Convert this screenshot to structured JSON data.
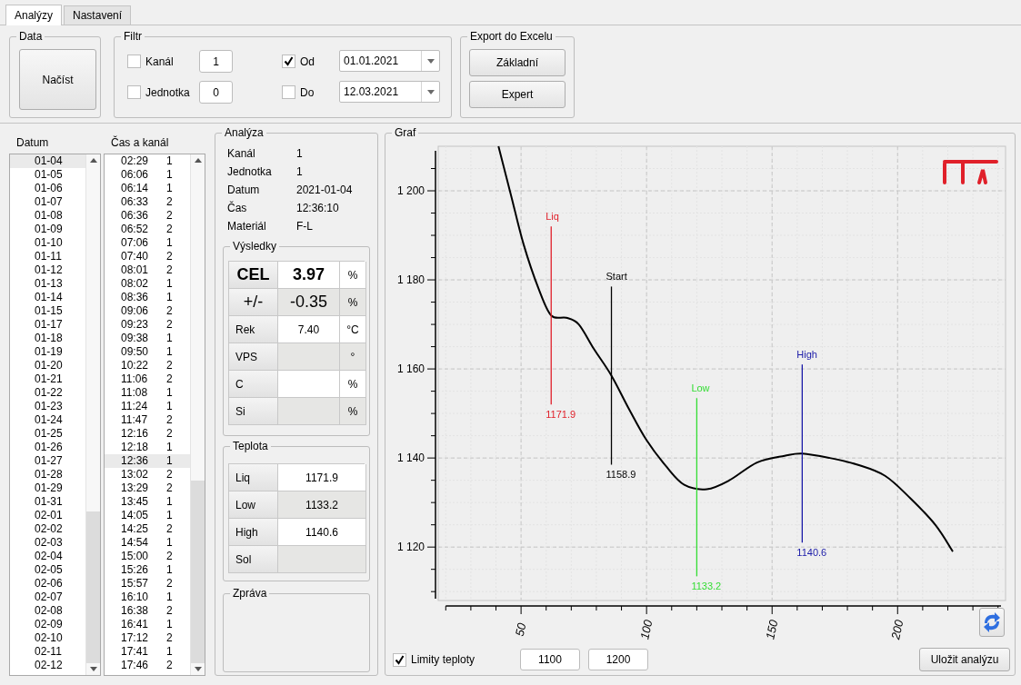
{
  "tabs": [
    {
      "label": "Analýzy",
      "selected": true
    },
    {
      "label": "Nastavení",
      "selected": false
    }
  ],
  "data_group": {
    "title": "Data",
    "button": "Načíst"
  },
  "filter": {
    "title": "Filtr",
    "fields": [
      {
        "label": "Kanál",
        "checked": false,
        "value": "1"
      },
      {
        "label": "Jednotka",
        "checked": false,
        "value": "0"
      }
    ],
    "dates": [
      {
        "label": "Od",
        "checked": true,
        "value": "01.01.2021"
      },
      {
        "label": "Do",
        "checked": false,
        "value": "12.03.2021"
      }
    ]
  },
  "export": {
    "title": "Export do Excelu",
    "buttons": [
      "Základní",
      "Expert"
    ]
  },
  "date_list": {
    "header": "Datum",
    "items": [
      {
        "label": "01-04",
        "selected": true
      },
      {
        "label": "01-05",
        "selected": false
      },
      {
        "label": "01-06",
        "selected": false
      },
      {
        "label": "01-07",
        "selected": false
      },
      {
        "label": "01-08",
        "selected": false
      },
      {
        "label": "01-09",
        "selected": false
      },
      {
        "label": "01-10",
        "selected": false
      },
      {
        "label": "01-11",
        "selected": false
      },
      {
        "label": "01-12",
        "selected": false
      },
      {
        "label": "01-13",
        "selected": false
      },
      {
        "label": "01-14",
        "selected": false
      },
      {
        "label": "01-15",
        "selected": false
      },
      {
        "label": "01-17",
        "selected": false
      },
      {
        "label": "01-18",
        "selected": false
      },
      {
        "label": "01-19",
        "selected": false
      },
      {
        "label": "01-20",
        "selected": false
      },
      {
        "label": "01-21",
        "selected": false
      },
      {
        "label": "01-22",
        "selected": false
      },
      {
        "label": "01-23",
        "selected": false
      },
      {
        "label": "01-24",
        "selected": false
      },
      {
        "label": "01-25",
        "selected": false
      },
      {
        "label": "01-26",
        "selected": false
      },
      {
        "label": "01-27",
        "selected": false
      },
      {
        "label": "01-28",
        "selected": false
      },
      {
        "label": "01-29",
        "selected": false
      },
      {
        "label": "01-31",
        "selected": false
      },
      {
        "label": "02-01",
        "selected": false
      },
      {
        "label": "02-02",
        "selected": false
      },
      {
        "label": "02-03",
        "selected": false
      },
      {
        "label": "02-04",
        "selected": false
      },
      {
        "label": "02-05",
        "selected": false
      },
      {
        "label": "02-06",
        "selected": false
      },
      {
        "label": "02-07",
        "selected": false
      },
      {
        "label": "02-08",
        "selected": false
      },
      {
        "label": "02-09",
        "selected": false
      },
      {
        "label": "02-10",
        "selected": false
      },
      {
        "label": "02-11",
        "selected": false
      },
      {
        "label": "02-12",
        "selected": false
      }
    ]
  },
  "time_list": {
    "header": "Čas a kanál",
    "items": [
      {
        "time": "02:29",
        "channel": "1",
        "selected": false
      },
      {
        "time": "06:06",
        "channel": "1",
        "selected": false
      },
      {
        "time": "06:14",
        "channel": "1",
        "selected": false
      },
      {
        "time": "06:33",
        "channel": "2",
        "selected": false
      },
      {
        "time": "06:36",
        "channel": "2",
        "selected": false
      },
      {
        "time": "06:52",
        "channel": "2",
        "selected": false
      },
      {
        "time": "07:06",
        "channel": "1",
        "selected": false
      },
      {
        "time": "07:40",
        "channel": "2",
        "selected": false
      },
      {
        "time": "08:01",
        "channel": "2",
        "selected": false
      },
      {
        "time": "08:02",
        "channel": "1",
        "selected": false
      },
      {
        "time": "08:36",
        "channel": "1",
        "selected": false
      },
      {
        "time": "09:06",
        "channel": "2",
        "selected": false
      },
      {
        "time": "09:23",
        "channel": "2",
        "selected": false
      },
      {
        "time": "09:38",
        "channel": "1",
        "selected": false
      },
      {
        "time": "09:50",
        "channel": "1",
        "selected": false
      },
      {
        "time": "10:22",
        "channel": "2",
        "selected": false
      },
      {
        "time": "11:06",
        "channel": "2",
        "selected": false
      },
      {
        "time": "11:08",
        "channel": "1",
        "selected": false
      },
      {
        "time": "11:24",
        "channel": "1",
        "selected": false
      },
      {
        "time": "11:47",
        "channel": "2",
        "selected": false
      },
      {
        "time": "12:16",
        "channel": "2",
        "selected": false
      },
      {
        "time": "12:18",
        "channel": "1",
        "selected": false
      },
      {
        "time": "12:36",
        "channel": "1",
        "selected": true
      },
      {
        "time": "13:02",
        "channel": "2",
        "selected": false
      },
      {
        "time": "13:29",
        "channel": "2",
        "selected": false
      },
      {
        "time": "13:45",
        "channel": "1",
        "selected": false
      },
      {
        "time": "14:05",
        "channel": "1",
        "selected": false
      },
      {
        "time": "14:25",
        "channel": "2",
        "selected": false
      },
      {
        "time": "14:54",
        "channel": "1",
        "selected": false
      },
      {
        "time": "15:00",
        "channel": "2",
        "selected": false
      },
      {
        "time": "15:26",
        "channel": "1",
        "selected": false
      },
      {
        "time": "15:57",
        "channel": "2",
        "selected": false
      },
      {
        "time": "16:10",
        "channel": "1",
        "selected": false
      },
      {
        "time": "16:38",
        "channel": "2",
        "selected": false
      },
      {
        "time": "16:41",
        "channel": "1",
        "selected": false
      },
      {
        "time": "17:12",
        "channel": "2",
        "selected": false
      },
      {
        "time": "17:41",
        "channel": "1",
        "selected": false
      },
      {
        "time": "17:46",
        "channel": "2",
        "selected": false
      }
    ]
  },
  "analysis": {
    "title": "Analýza",
    "fields": [
      {
        "label": "Kanál",
        "value": "1"
      },
      {
        "label": "Jednotka",
        "value": "1"
      },
      {
        "label": "Datum",
        "value": "2021-01-04"
      },
      {
        "label": "Čas",
        "value": "12:36:10"
      },
      {
        "label": "Materiál",
        "value": "F-L"
      }
    ],
    "results": {
      "title": "Výsledky",
      "rows": [
        {
          "kind": "primary",
          "label": "CEL",
          "value": "3.97",
          "unit": "%"
        },
        {
          "kind": "secondary",
          "label": "+/-",
          "value": "-0.35",
          "unit": "%"
        },
        {
          "kind": "normal",
          "label": "Rek",
          "value": "7.40",
          "unit": "°C"
        },
        {
          "kind": "normal",
          "label": "VPS",
          "unit": "°"
        },
        {
          "kind": "normal",
          "label": "C",
          "unit": "%"
        },
        {
          "kind": "normal",
          "label": "Si",
          "unit": "%"
        }
      ]
    },
    "temperatures": {
      "title": "Teplota",
      "rows": [
        {
          "label": "Liq",
          "value": "1171.9"
        },
        {
          "label": "Low",
          "value": "1133.2"
        },
        {
          "label": "High",
          "value": "1140.6"
        },
        {
          "label": "Sol"
        }
      ]
    },
    "message": {
      "title": "Zpráva"
    }
  },
  "graph": {
    "title": "Graf",
    "chart_data": {
      "type": "line",
      "xlim": [
        17,
        243
      ],
      "ylim": [
        1108,
        1210
      ],
      "xticks": [
        50,
        100,
        150,
        200
      ],
      "yticks": [
        {
          "value": 1120,
          "label": "1 120"
        },
        {
          "value": 1140,
          "label": "1 140"
        },
        {
          "value": 1160,
          "label": "1 160"
        },
        {
          "value": 1180,
          "label": "1 180"
        },
        {
          "value": 1200,
          "label": "1 200"
        }
      ],
      "x": [
        41,
        46,
        51,
        57,
        62,
        68,
        73,
        79,
        86,
        93,
        100,
        108,
        115,
        124,
        133,
        144,
        155,
        162,
        173,
        184,
        195,
        205,
        215,
        222
      ],
      "series": [
        {
          "color": "#000000",
          "values": [
            1210,
            1199,
            1188,
            1178,
            1172,
            1171.5,
            1170,
            1164.5,
            1158.5,
            1151,
            1144,
            1138,
            1134,
            1133,
            1135,
            1139,
            1140.5,
            1141,
            1140,
            1138.5,
            1136,
            1131,
            1125,
            1119
          ]
        }
      ],
      "grid": true,
      "ref_lines": [
        {
          "axis": "x",
          "value": 62,
          "label": "Liq",
          "color": "#e0202a"
        },
        {
          "axis": "x",
          "value": 86,
          "label": "Start",
          "color": "#000000"
        },
        {
          "axis": "x",
          "value": 120,
          "label": "Low",
          "color": "#33dd33"
        },
        {
          "axis": "x",
          "value": 162,
          "label": "High",
          "color": "#1a1aa8"
        }
      ],
      "annotations": [
        "1171.9",
        "1158.9",
        "1133.2",
        "1140.6"
      ]
    },
    "limits": {
      "label": "Limity teploty",
      "checked": true,
      "min": "1100",
      "max": "1200"
    },
    "save_button": "Uložit analýzu"
  }
}
